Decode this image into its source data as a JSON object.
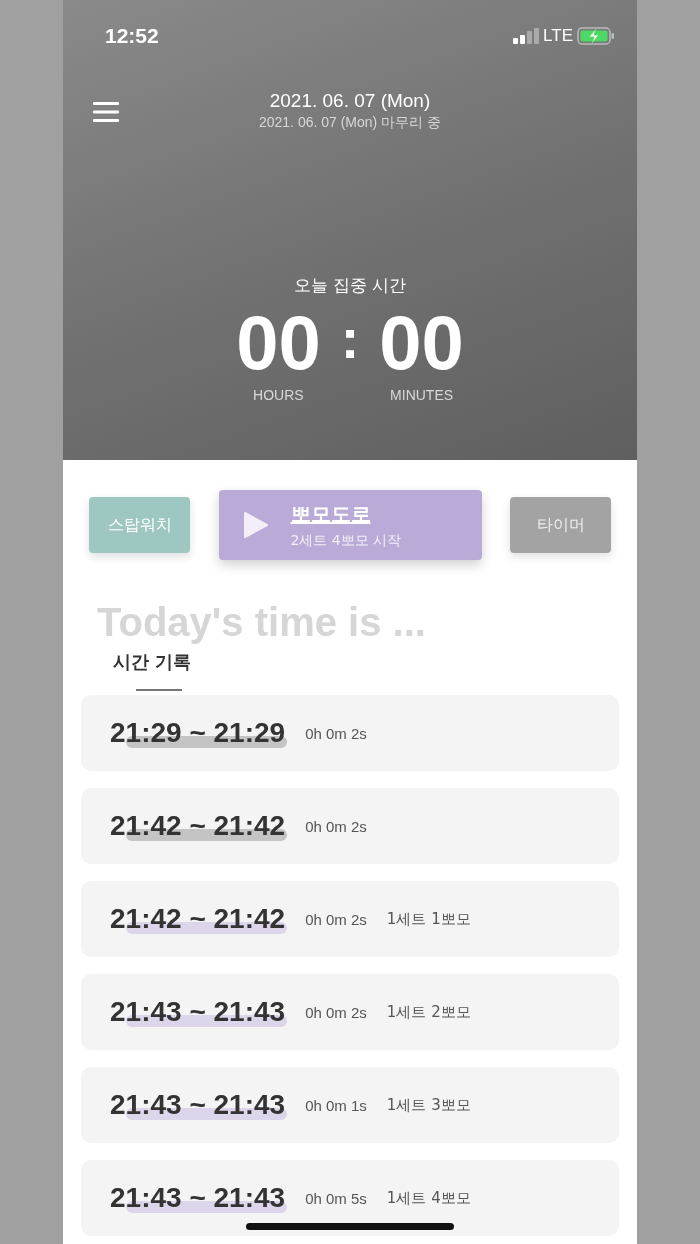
{
  "status_bar": {
    "time": "12:52",
    "network": "LTE"
  },
  "header": {
    "date": "2021. 06. 07 (Mon)",
    "subtitle": "2021. 06. 07 (Mon) 마무리 중"
  },
  "focus": {
    "label": "오늘 집중 시간",
    "hours": "00",
    "separator": ":",
    "minutes": "00",
    "hours_label": "HOURS",
    "minutes_label": "MINUTES"
  },
  "modes": [
    {
      "kind": "stopwatch",
      "label": "스탑워치",
      "selected": false
    },
    {
      "kind": "pomodoro",
      "label": "뽀모도로",
      "sub": "2세트 4뽀모 시작",
      "selected": true
    },
    {
      "kind": "timer",
      "label": "타이머",
      "selected": false
    }
  ],
  "records_section": {
    "watermark": "Today's time is ...",
    "title": "시간 기록"
  },
  "records": [
    {
      "range": "21:29 ~ 21:29",
      "duration": "0h 0m 2s",
      "color": "#c4c4c4"
    },
    {
      "range": "21:42 ~ 21:42",
      "duration": "0h 0m 2s",
      "color": "#c4c4c4"
    },
    {
      "range": "21:42 ~ 21:42",
      "duration": "0h 0m 2s",
      "session": "1세트 1뽀모",
      "color": "#ddd5ea"
    },
    {
      "range": "21:43 ~ 21:43",
      "duration": "0h 0m 2s",
      "session": "1세트 2뽀모",
      "color": "#ddd5ea"
    },
    {
      "range": "21:43 ~ 21:43",
      "duration": "0h 0m 1s",
      "session": "1세트 3뽀모",
      "color": "#ddd5ea"
    },
    {
      "range": "21:43 ~ 21:43",
      "duration": "0h 0m 5s",
      "session": "1세트 4뽀모",
      "color": "#ddd5ea"
    }
  ]
}
